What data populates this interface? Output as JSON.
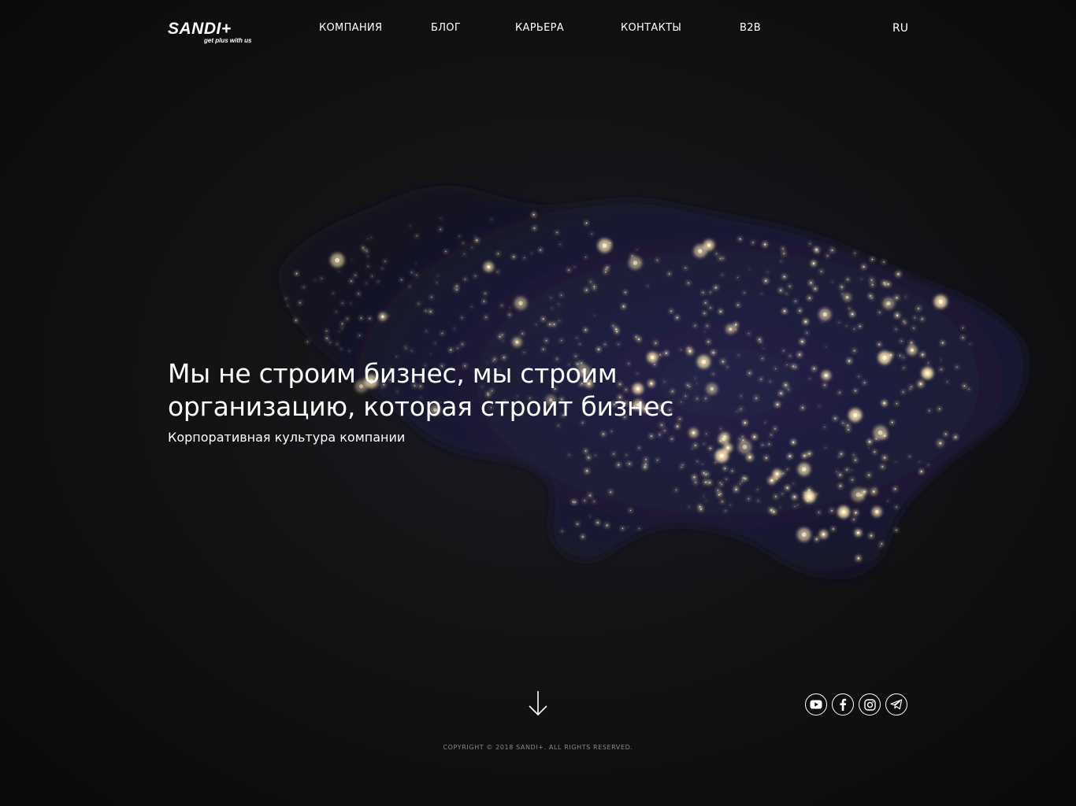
{
  "brand": {
    "logo_text": "SANDI+",
    "tagline": "get plus with us"
  },
  "nav": {
    "items": [
      {
        "label": "КОМПАНИЯ"
      },
      {
        "label": "БЛОГ"
      },
      {
        "label": "КАРЬЕРА"
      },
      {
        "label": "КОНТАКТЫ"
      },
      {
        "label": "B2B"
      }
    ],
    "language": "RU"
  },
  "hero": {
    "title_line1": "Мы не строим бизнес, мы строим",
    "title_line2": "организацию, которая строит бизнес",
    "subtitle": "Корпоративная культура компании"
  },
  "socials": [
    {
      "icon": "youtube-icon"
    },
    {
      "icon": "facebook-icon"
    },
    {
      "icon": "instagram-icon"
    },
    {
      "icon": "telegram-icon"
    }
  ],
  "footer": {
    "copyright": "COPYRIGHT © 2018 SANDI+. ALL RIGHTS RESERVED."
  },
  "colors": {
    "background": "#0d0d0e",
    "text": "#ffffff",
    "city_lights": "#ffe9b0",
    "map_tint": "#1d1c3a",
    "copyright": "#8a8a8a"
  }
}
